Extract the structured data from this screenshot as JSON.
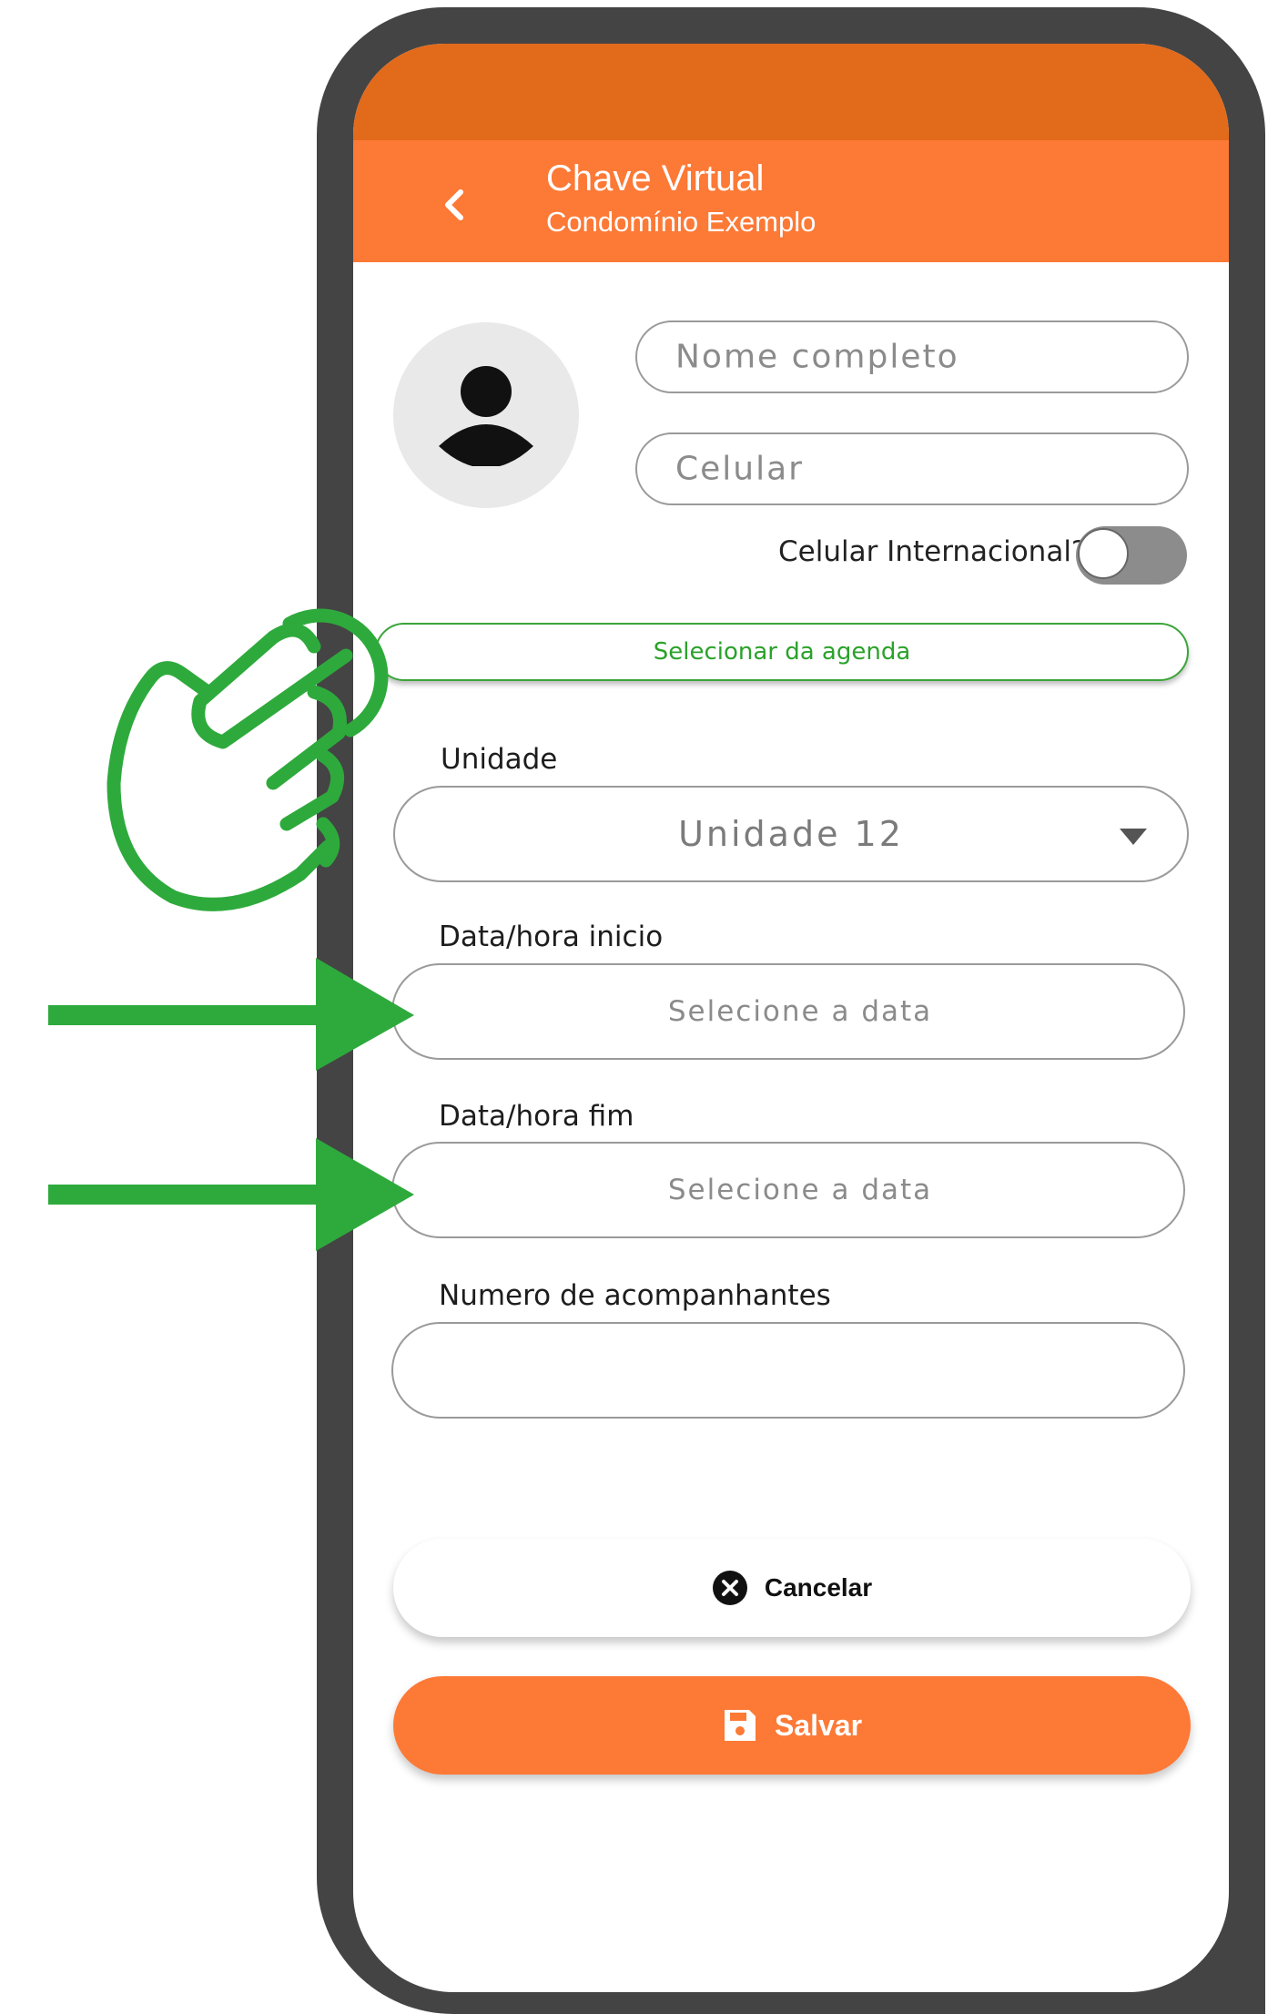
{
  "header": {
    "title": "Chave Virtual",
    "subtitle": "Condomínio Exemplo"
  },
  "form": {
    "name_placeholder": "Nome completo",
    "phone_placeholder": "Celular",
    "intl_label": "Celular Internacional?",
    "intl_toggle_on": false,
    "agenda_button": "Selecionar da agenda",
    "unit_label": "Unidade",
    "unit_value": "Unidade 12",
    "start_label": "Data/hora inicio",
    "start_value": "Selecione a data",
    "end_label": "Data/hora fim",
    "end_value": "Selecione a data",
    "companions_label": "Numero de acompanhantes",
    "companions_value": ""
  },
  "actions": {
    "cancel_label": "Cancelar",
    "save_label": "Salvar"
  },
  "colors": {
    "brand_orange": "#fd7936",
    "status_orange": "#e26a1b",
    "annotation_green": "#2eaa3c",
    "agenda_green": "#2aa22a"
  },
  "annotations": {
    "icons": [
      "tap-hand-icon",
      "arrow-right-icon",
      "arrow-right-icon"
    ]
  }
}
